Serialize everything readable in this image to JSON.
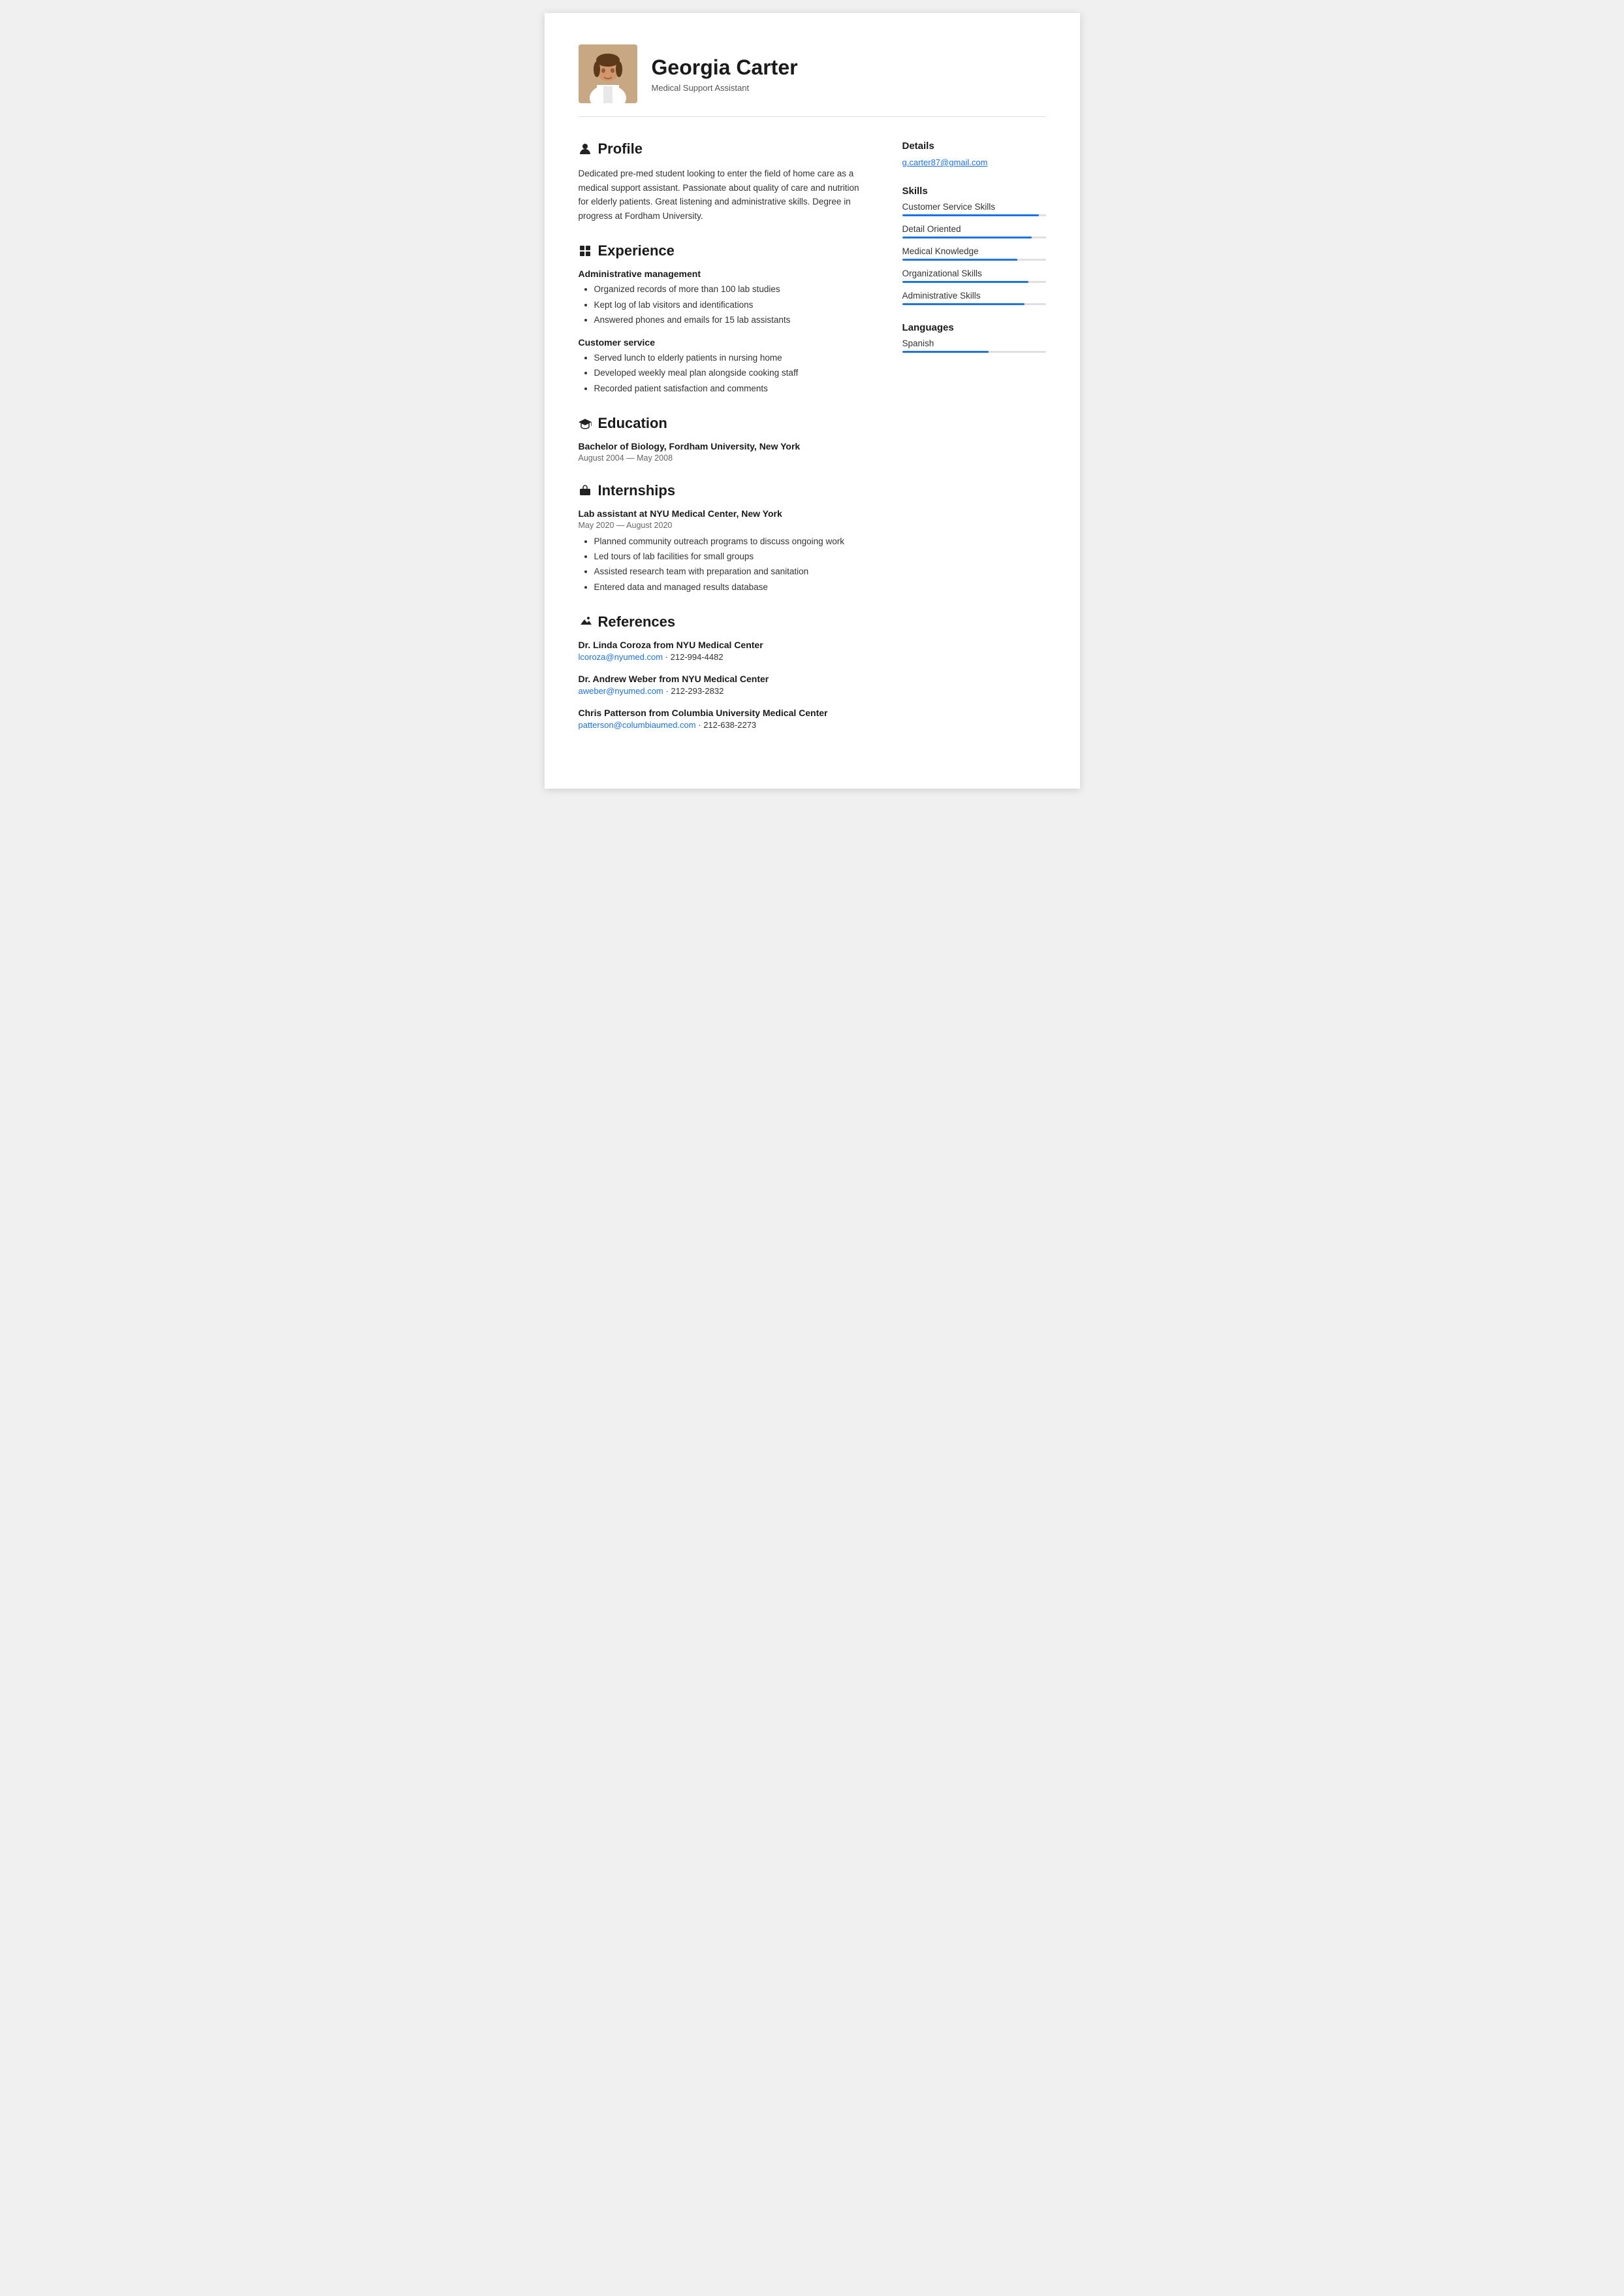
{
  "header": {
    "name": "Georgia Carter",
    "title": "Medical Support Assistant"
  },
  "profile": {
    "section_title": "Profile",
    "text": "Dedicated pre-med student looking to enter the field of home care as a medical support assistant. Passionate about quality of care and nutrition for elderly patients. Great listening and administrative skills. Degree in progress at Fordham University."
  },
  "experience": {
    "section_title": "Experience",
    "jobs": [
      {
        "title": "Administrative management",
        "bullets": [
          "Organized records of more than 100 lab studies",
          "Kept log of lab visitors and identifications",
          "Answered phones and emails for 15 lab assistants"
        ]
      },
      {
        "title": "Customer service",
        "bullets": [
          "Served lunch to elderly patients in nursing home",
          "Developed weekly meal plan alongside cooking staff",
          "Recorded patient satisfaction and comments"
        ]
      }
    ]
  },
  "education": {
    "section_title": "Education",
    "degree": "Bachelor of Biology, Fordham University, New York",
    "dates": "August 2004 — May 2008"
  },
  "internships": {
    "section_title": "Internships",
    "title": "Lab assistant at NYU Medical Center, New York",
    "dates": "May 2020 — August 2020",
    "bullets": [
      "Planned community outreach programs to discuss ongoing work",
      "Led tours of lab facilities for small groups",
      "Assisted research team with preparation and sanitation",
      "Entered data and managed results database"
    ]
  },
  "references": {
    "section_title": "References",
    "items": [
      {
        "name": "Dr. Linda Coroza from NYU Medical Center",
        "email": "lcoroza@nyumed.com",
        "phone": "212-994-4482"
      },
      {
        "name": "Dr. Andrew Weber from NYU Medical Center",
        "email": "aweber@nyumed.com",
        "phone": "212-293-2832"
      },
      {
        "name": "Chris Patterson from Columbia University Medical Center",
        "email": "patterson@columbiaumed.com",
        "phone": "212-638-2273"
      }
    ]
  },
  "details": {
    "section_title": "Details",
    "email": "g.carter87@gmail.com"
  },
  "skills": {
    "section_title": "Skills",
    "items": [
      {
        "name": "Customer Service Skills",
        "level": 95
      },
      {
        "name": "Detail Oriented",
        "level": 90
      },
      {
        "name": "Medical Knowledge",
        "level": 80
      },
      {
        "name": "Organizational Skills",
        "level": 88
      },
      {
        "name": "Administrative Skills",
        "level": 85
      }
    ]
  },
  "languages": {
    "section_title": "Languages",
    "items": [
      {
        "name": "Spanish",
        "level": 60
      }
    ]
  },
  "icons": {
    "profile": "person",
    "experience": "grid",
    "education": "graduation-cap",
    "internships": "briefcase",
    "references": "megaphone"
  }
}
